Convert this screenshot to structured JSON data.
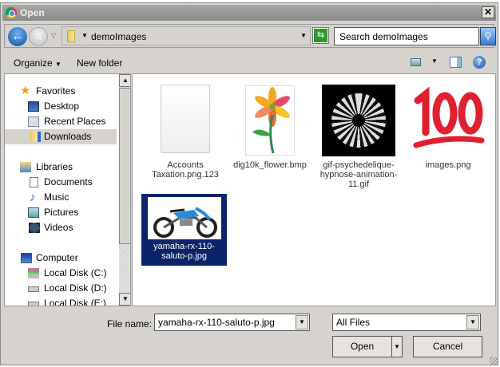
{
  "title": "Open",
  "address": {
    "path": "demoImages",
    "search_placeholder": "Search demoImages"
  },
  "toolbar": {
    "organize": "Organize",
    "new_folder": "New folder"
  },
  "nav": {
    "favorites": "Favorites",
    "desktop": "Desktop",
    "recent": "Recent Places",
    "downloads": "Downloads",
    "libraries": "Libraries",
    "documents": "Documents",
    "music": "Music",
    "pictures": "Pictures",
    "videos": "Videos",
    "computer": "Computer",
    "disk_c": "Local Disk (C:)",
    "disk_d": "Local Disk (D:)",
    "disk_e": "Local Disk (E:)"
  },
  "files": [
    {
      "name": "Accounts Taxation.png.123"
    },
    {
      "name": "dig10k_flower.bmp"
    },
    {
      "name": "gif-psychedelique-hypnose-animation-11.gif"
    },
    {
      "name": "images.png"
    },
    {
      "name": "yamaha-rx-110-saluto-p.jpg"
    }
  ],
  "bottom": {
    "file_name_label": "File name:",
    "file_name_value": "yamaha-rx-110-saluto-p.jpg",
    "file_type": "All Files",
    "open": "Open",
    "cancel": "Cancel"
  }
}
